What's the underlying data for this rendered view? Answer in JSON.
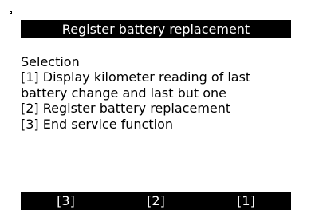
{
  "screen": {
    "title": "Register battery replacement"
  },
  "content": {
    "heading": "Selection",
    "option1_line1": "[1] Display kilometer reading of last",
    "option1_line2": "battery change and last but one",
    "option2": "[2] Register battery replacement",
    "option3": "[3] End service function"
  },
  "softkeys": {
    "left": "[3]",
    "middle": "[2]",
    "right": "[1]"
  }
}
